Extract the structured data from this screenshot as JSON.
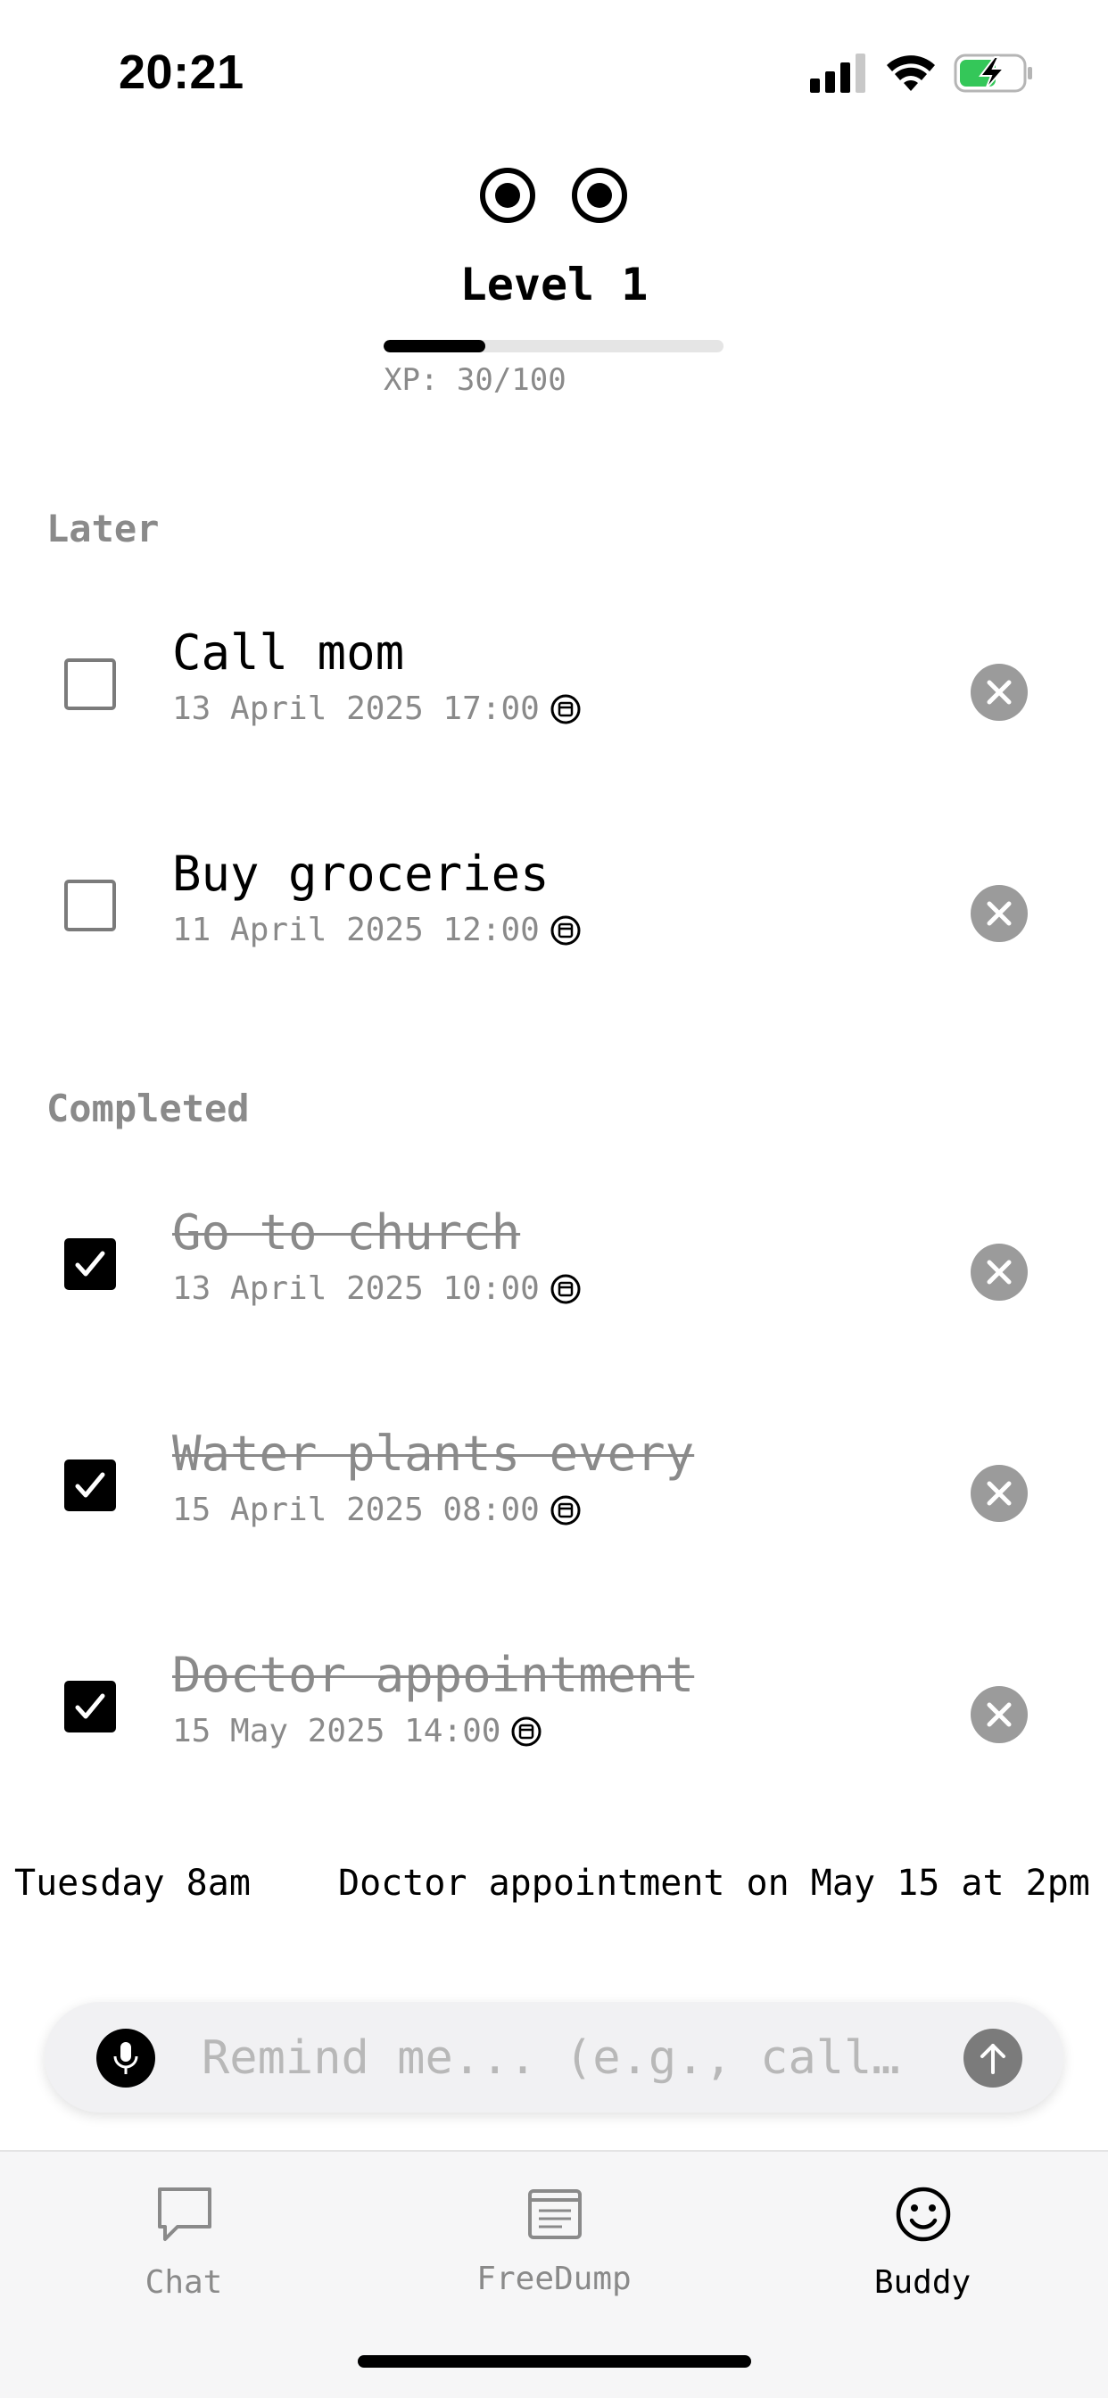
{
  "status_bar": {
    "time": "20:21"
  },
  "buddy": {
    "level_label": "Level 1",
    "xp_text": "XP: 30/100",
    "xp_progress": 0.3
  },
  "sections": {
    "later_title": "Later",
    "completed_title": "Completed"
  },
  "later_tasks": [
    {
      "title": "Call mom",
      "date": "13 April 2025 17:00",
      "done": false
    },
    {
      "title": "Buy groceries",
      "date": "11 April 2025 12:00",
      "done": false
    }
  ],
  "completed_tasks": [
    {
      "title": "Go to church",
      "date": "13 April 2025 10:00",
      "done": true
    },
    {
      "title": "Water plants every",
      "date": "15 April 2025 08:00",
      "done": true
    },
    {
      "title": "Doctor appointment",
      "date": "15 May 2025 14:00",
      "done": true
    }
  ],
  "suggestions": [
    "Tuesday 8am",
    "Doctor appointment on May 15 at 2pm"
  ],
  "input": {
    "placeholder": "Remind me... (e.g., call…"
  },
  "tabs": [
    {
      "label": "Chat",
      "icon": "chat-bubble-icon",
      "active": false
    },
    {
      "label": "FreeDump",
      "icon": "notes-icon",
      "active": false
    },
    {
      "label": "Buddy",
      "icon": "smiley-icon",
      "active": true
    }
  ],
  "colors": {
    "accent": "#000000",
    "muted": "#8a8a8a",
    "battery_green": "#34c759"
  },
  "icons": [
    "signal-icon",
    "wifi-icon",
    "battery-charging-icon",
    "calendar-icon",
    "close-icon",
    "checkmark-icon",
    "microphone-icon",
    "arrow-up-icon"
  ]
}
